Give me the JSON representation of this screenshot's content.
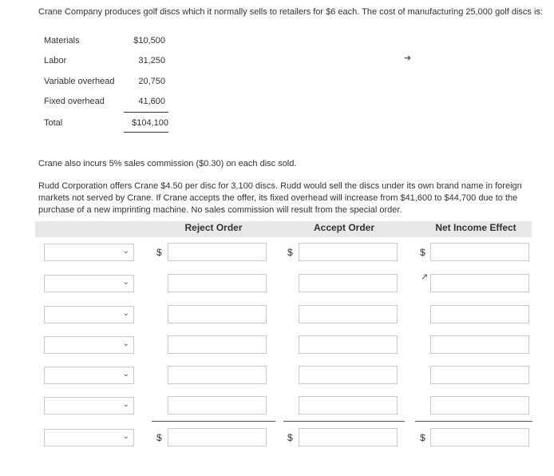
{
  "intro": "Crane Company produces golf discs which it normally sells to retailers for $6 each. The cost of manufacturing 25,000 golf discs is:",
  "costs": [
    {
      "label": "Materials",
      "value": "$10,500"
    },
    {
      "label": "Labor",
      "value": "31,250"
    },
    {
      "label": "Variable overhead",
      "value": "20,750"
    },
    {
      "label": "Fixed overhead",
      "value": "41,600"
    }
  ],
  "total": {
    "label": "Total",
    "value": "$104,100"
  },
  "commission_text": "Crane also incurs 5% sales commission ($0.30) on each disc sold.",
  "offer_text": "Rudd Corporation offers Crane $4.50 per disc for 3,100 discs. Rudd would sell the discs under its own brand name in foreign markets not served by Crane. If Crane accepts the offer, its fixed overhead will increase from $41,600 to $44,700 due to the purchase of a new imprinting machine. No sales commission will result from the special order.",
  "table": {
    "headers": [
      "Reject Order",
      "Accept Order",
      "Net Income Effect"
    ],
    "currency": "$",
    "chevron": "chevron-down-icon",
    "rows": 7
  }
}
